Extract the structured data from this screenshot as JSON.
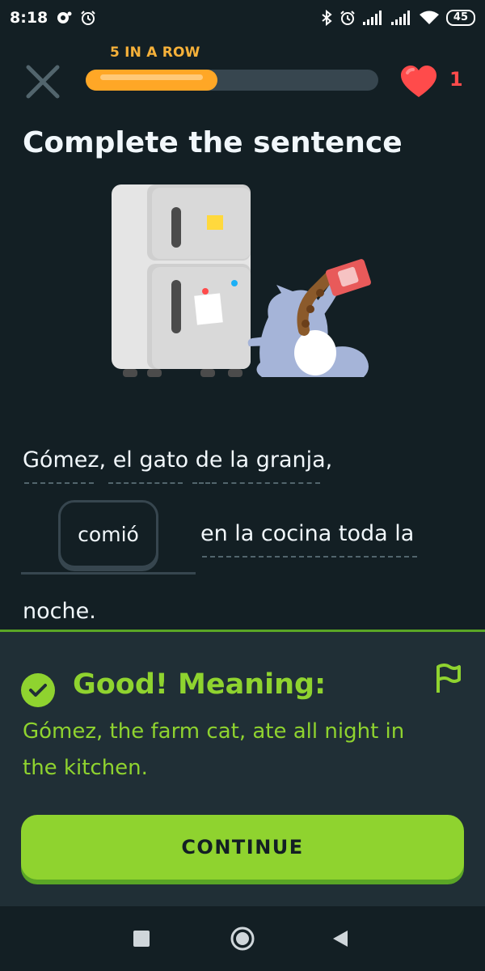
{
  "status_bar": {
    "time": "8:18",
    "battery": "45",
    "icons": [
      "notification-icon",
      "alarm-icon",
      "bluetooth-icon",
      "alarm-icon",
      "signal-icon",
      "signal-icon",
      "wifi-icon",
      "battery-icon"
    ]
  },
  "header": {
    "streak_label": "5 IN A ROW",
    "progress": 0.45,
    "hearts": "1"
  },
  "title": "Complete the sentence",
  "sentence": {
    "line1": "Gómez, el gato de la granja,",
    "answer": "comió",
    "line2_rest": "en la cocina toda la",
    "line3": "noche."
  },
  "feedback": {
    "title": "Good! Meaning:",
    "meaning": "Gómez, the farm cat, ate all night in the kitchen.",
    "continue_label": "CONTINUE"
  },
  "colors": {
    "background": "#131f24",
    "accent_green": "#8fd32f",
    "streak_orange": "#ffa726",
    "heart_red": "#ff4b4b"
  }
}
